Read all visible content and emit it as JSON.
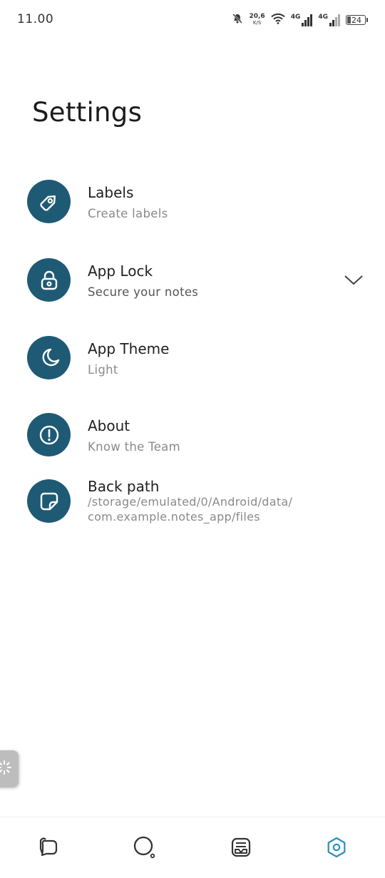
{
  "status_bar": {
    "time": "11.00",
    "net_speed_value": "20,6",
    "net_speed_unit": "K/S",
    "signal_1_label": "4G",
    "signal_2_label": "4G",
    "battery": "24"
  },
  "page_title": "Settings",
  "settings": [
    {
      "title": "Labels",
      "subtitle": "Create labels",
      "icon": "tag-icon"
    },
    {
      "title": "App Lock",
      "subtitle": "Secure your notes",
      "icon": "lock-icon"
    },
    {
      "title": "App Theme",
      "subtitle": "Light",
      "icon": "moon-icon"
    },
    {
      "title": "About",
      "subtitle": "Know the Team",
      "icon": "info-icon"
    },
    {
      "title": "Back path",
      "subtitle_line1": "/storage/emulated/0/Android/data/",
      "subtitle_line2": "com.example.notes_app/files",
      "icon": "note-icon"
    }
  ],
  "bottom_nav": [
    {
      "icon": "notes-icon",
      "active": false
    },
    {
      "icon": "search-icon",
      "active": false
    },
    {
      "icon": "archive-icon",
      "active": false
    },
    {
      "icon": "settings-icon",
      "active": true
    }
  ],
  "colors": {
    "accent": "#1f5a75",
    "active_nav": "#2a8fbd",
    "inactive_nav": "#333333",
    "subtitle": "#8a8a8a"
  }
}
